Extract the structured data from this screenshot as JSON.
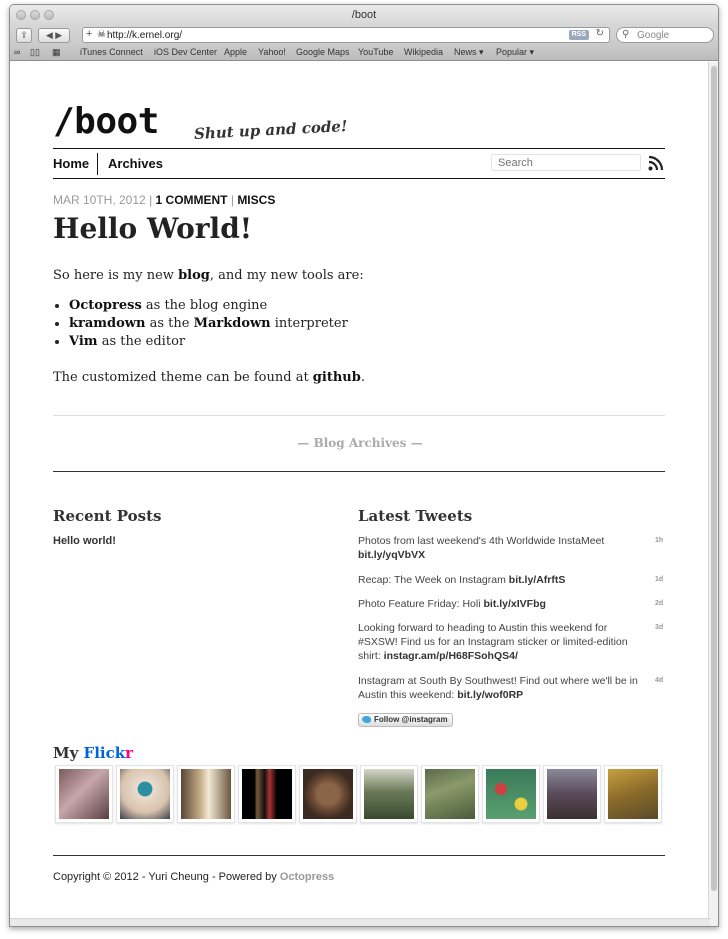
{
  "browser": {
    "window_title": "/boot",
    "url": "http://k.ernel.org/",
    "rss_label": "RSS",
    "search_placeholder": "Google",
    "bookmarks": [
      "iTunes Connect",
      "iOS Dev Center",
      "Apple",
      "Yahoo!",
      "Google Maps",
      "YouTube",
      "Wikipedia",
      "News ▾",
      "Popular ▾"
    ]
  },
  "site": {
    "title": "/boot",
    "tagline": "Shut up and code!",
    "nav": {
      "home": "Home",
      "archives": "Archives"
    },
    "search_placeholder": "Search"
  },
  "post": {
    "date": "MAR 10TH, 2012",
    "comments": "1 COMMENT",
    "category": "MISCS",
    "title": "Hello World!",
    "intro_a": "So here is my new ",
    "intro_b": "blog",
    "intro_c": ", and my new tools are:",
    "items": [
      {
        "bold": "Octopress",
        "rest": " as the blog engine"
      },
      {
        "bold": "kramdown",
        "rest": " as the ",
        "bold2": "Markdown",
        "rest2": " interpreter"
      },
      {
        "bold": "Vim",
        "rest": " as the editor"
      }
    ],
    "theme_a": "The customized theme can be found at ",
    "theme_b": "github",
    "theme_c": "."
  },
  "archives_link": "— Blog Archives —",
  "recent_posts": {
    "heading": "Recent Posts",
    "items": [
      "Hello world!"
    ]
  },
  "tweets": {
    "heading": "Latest Tweets",
    "items": [
      {
        "text": "Photos from last weekend's 4th Worldwide InstaMeet ",
        "link": "bit.ly/yqVbVX",
        "age": "1h"
      },
      {
        "text": "Recap: The Week on Instagram ",
        "link": "bit.ly/AfrftS",
        "age": "1d"
      },
      {
        "text": "Photo Feature Friday: Holi ",
        "link": "bit.ly/xIVFbg",
        "age": "2d"
      },
      {
        "text": "Looking forward to heading to Austin this weekend for #SXSW! Find us for an Instagram sticker or limited-edition shirt: ",
        "link": "instagr.am/p/H68FSohQS4/",
        "age": "3d"
      },
      {
        "text": "Instagram at South By Southwest! Find out where we'll be in Austin this weekend: ",
        "link": "bit.ly/wof0RP",
        "age": "4d"
      }
    ],
    "follow_button": "Follow @instagram"
  },
  "flickr": {
    "heading_a": "My ",
    "heading_b": "Flick",
    "heading_c": "r",
    "photos": [
      "photo-1",
      "photo-2",
      "photo-3",
      "photo-4",
      "photo-5",
      "photo-6",
      "photo-7",
      "photo-8",
      "photo-9",
      "photo-10"
    ]
  },
  "footer": {
    "copyright": "Copyright © 2012 - Yuri Cheung - Powered by ",
    "powered": "Octopress"
  }
}
